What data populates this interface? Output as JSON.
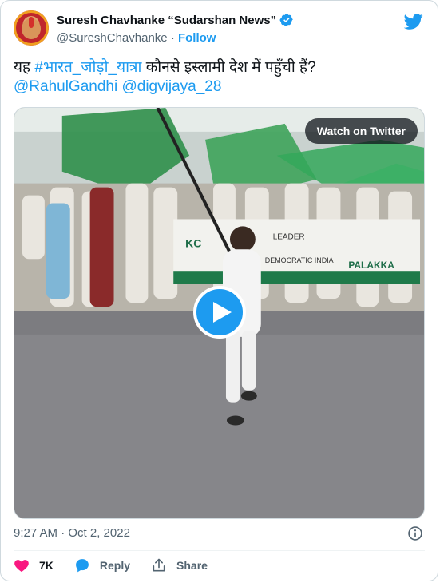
{
  "author": {
    "display_name": "Suresh Chavhanke “Sudarshan News”",
    "handle": "@SureshChavhanke",
    "separator": "·",
    "follow_label": "Follow"
  },
  "tweet": {
    "text_prefix": "यह ",
    "hashtag": "#भारत_जोड़ो_यात्रा",
    "text_suffix": " कौनसे इस्लामी देश में पहुँची हैं?",
    "mention_1": "@RahulGandhi",
    "mention_2": "@digvijaya_28"
  },
  "media": {
    "watch_label": "Watch on Twitter",
    "play_icon": "play-icon"
  },
  "meta": {
    "timestamp": "9:27 AM · Oct 2, 2022"
  },
  "actions": {
    "like_count": "7K",
    "reply_label": "Reply",
    "share_label": "Share"
  },
  "colors": {
    "accent": "#1d9bf0",
    "like": "#f91880",
    "text": "#0f1419",
    "muted": "#536471"
  }
}
